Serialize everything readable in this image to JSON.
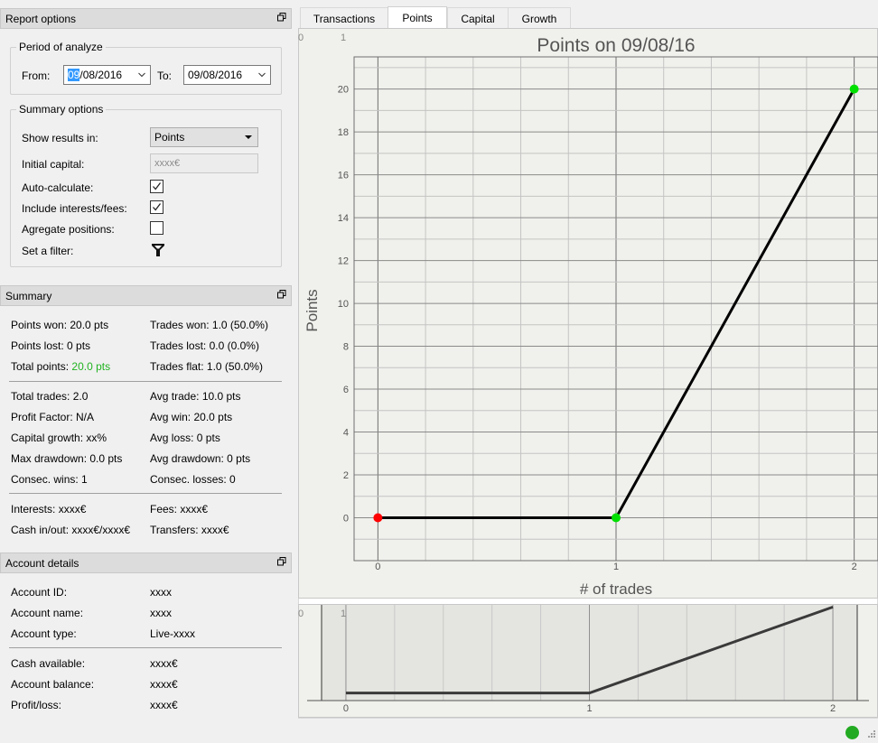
{
  "report_options": {
    "title": "Report options",
    "period": {
      "title": "Period of analyze",
      "from_label": "From:",
      "from_value_sel": "09",
      "from_value_rest": "/08/2016",
      "to_label": "To:",
      "to_value": "09/08/2016"
    },
    "summary_options": {
      "title": "Summary options",
      "show_results_label": "Show results in:",
      "show_results_value": "Points",
      "initial_capital_label": "Initial capital:",
      "initial_capital_placeholder": "xxxx€",
      "auto_calc_label": "Auto-calculate:",
      "auto_calc_checked": true,
      "include_interests_label": "Include interests/fees:",
      "include_interests_checked": true,
      "aggregate_label": "Agregate positions:",
      "aggregate_checked": false,
      "filter_label": "Set a filter:"
    }
  },
  "summary": {
    "title": "Summary",
    "points_won": "Points won: 20.0 pts",
    "trades_won": "Trades won: 1.0 (50.0%)",
    "points_lost": "Points lost: 0 pts",
    "trades_lost": "Trades lost: 0.0 (0.0%)",
    "total_points_label": "Total points:",
    "total_points_value": "20.0 pts",
    "trades_flat": "Trades flat: 1.0 (50.0%)",
    "total_trades": "Total trades: 2.0",
    "avg_trade": "Avg trade: 10.0 pts",
    "profit_factor": "Profit Factor: N/A",
    "avg_win": "Avg win: 20.0 pts",
    "capital_growth": "Capital growth: xx%",
    "avg_loss": "Avg loss: 0 pts",
    "max_drawdown": "Max drawdown: 0.0 pts",
    "avg_drawdown": "Avg drawdown: 0 pts",
    "consec_wins": "Consec. wins: 1",
    "consec_losses": "Consec. losses: 0",
    "interests": "Interests: xxxx€",
    "fees": "Fees: xxxx€",
    "cash_inout": "Cash in/out: xxxx€/xxxx€",
    "transfers": "Transfers: xxxx€"
  },
  "account": {
    "title": "Account details",
    "id_label": "Account ID:",
    "id_value": "xxxx",
    "name_label": "Account name:",
    "name_value": "xxxx",
    "type_label": "Account type:",
    "type_value": "Live-xxxx",
    "cash_label": "Cash available:",
    "cash_value": "xxxx€",
    "balance_label": "Account balance:",
    "balance_value": "xxxx€",
    "pl_label": "Profit/loss:",
    "pl_value": "xxxx€"
  },
  "tabs": [
    "Transactions",
    "Points",
    "Capital",
    "Growth"
  ],
  "active_tab": "Points",
  "chart_data": {
    "type": "line",
    "title": "Points on 09/08/16",
    "xlabel": "# of trades",
    "ylabel": "Points",
    "x": [
      0,
      1,
      2
    ],
    "y": [
      0,
      0,
      20
    ],
    "point_colors": [
      "#ff0000",
      "#00e000",
      "#00e000"
    ],
    "xlim": [
      -0.1,
      2.1
    ],
    "ylim": [
      -2,
      21.5
    ],
    "xticks": [
      0,
      1,
      2
    ],
    "yticks": [
      0,
      2,
      4,
      6,
      8,
      10,
      12,
      14,
      16,
      18,
      20
    ],
    "grid": true,
    "corner_labels": [
      "0",
      "1"
    ],
    "overview_corner_labels": [
      "0",
      "1"
    ],
    "overview_xticks": [
      0,
      1,
      2
    ]
  },
  "colors": {
    "status_indicator": "#22aa22",
    "positive": "#21b321"
  }
}
